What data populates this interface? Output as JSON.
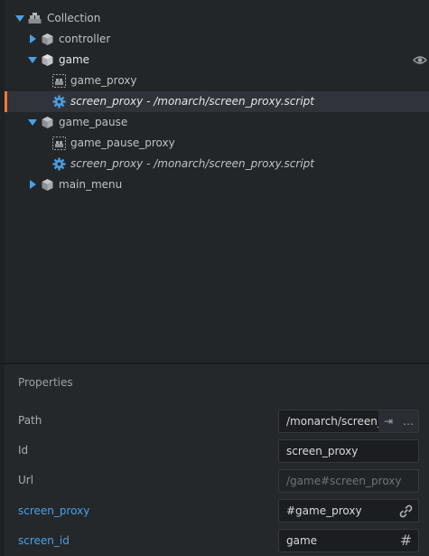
{
  "outline": {
    "items": [
      {
        "label": "Collection",
        "icon": "collection-icon",
        "arrow": "down"
      },
      {
        "label": "controller",
        "icon": "game-object-icon",
        "arrow": "right"
      },
      {
        "label": "game",
        "icon": "game-object-icon",
        "arrow": "down"
      },
      {
        "label": "game_proxy",
        "icon": "collection-proxy-icon"
      },
      {
        "label": "screen_proxy - /monarch/screen_proxy.script",
        "icon": "script-gear-icon",
        "selected": true
      },
      {
        "label": "game_pause",
        "icon": "game-object-icon",
        "arrow": "down"
      },
      {
        "label": "game_pause_proxy",
        "icon": "collection-proxy-icon"
      },
      {
        "label": "screen_proxy - /monarch/screen_proxy.script",
        "icon": "script-gear-icon"
      },
      {
        "label": "main_menu",
        "icon": "game-object-icon",
        "arrow": "right"
      }
    ],
    "visibility_icon": "eye-icon"
  },
  "properties": {
    "title": "Properties",
    "rows": [
      {
        "label": "Path",
        "value": "/monarch/screen_proxy.script"
      },
      {
        "label": "Id",
        "value": "screen_proxy"
      },
      {
        "label": "Url",
        "value": "/game#screen_proxy"
      },
      {
        "label": "screen_proxy",
        "value": "#game_proxy"
      },
      {
        "label": "screen_id",
        "value": "game"
      }
    ],
    "path_buttons": {
      "goto": "⇥",
      "browse": "…"
    },
    "hash_symbol": "#"
  },
  "colors": {
    "accent_blue": "#4aa0e6",
    "selection_bar": "#f07a38",
    "background": "#232629"
  }
}
